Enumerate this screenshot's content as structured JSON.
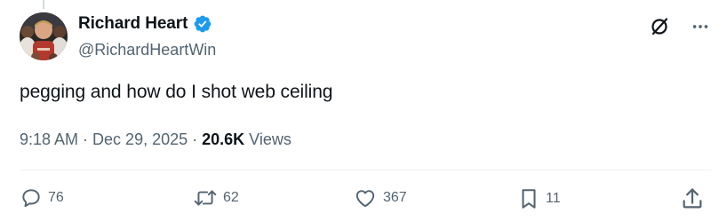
{
  "author": {
    "display_name": "Richard Heart",
    "handle": "@RichardHeartWin",
    "verified": true,
    "verified_color": "#1d9bf0"
  },
  "tweet": {
    "text": "pegging and how do I shot web ceiling",
    "time": "9:18 AM",
    "date": "Dec 29, 2025",
    "separator": "·",
    "views_count": "20.6K",
    "views_label": "Views"
  },
  "icons": {
    "grok": "grok-icon",
    "more": "more-icon",
    "reply": "reply-icon",
    "retweet": "retweet-icon",
    "like": "like-icon",
    "bookmark": "bookmark-icon",
    "share": "share-icon"
  },
  "stats": {
    "replies": "76",
    "retweets": "62",
    "likes": "367",
    "bookmarks": "11"
  },
  "colors": {
    "text_primary": "#0f1419",
    "text_secondary": "#536471",
    "divider": "#eff3f4"
  }
}
